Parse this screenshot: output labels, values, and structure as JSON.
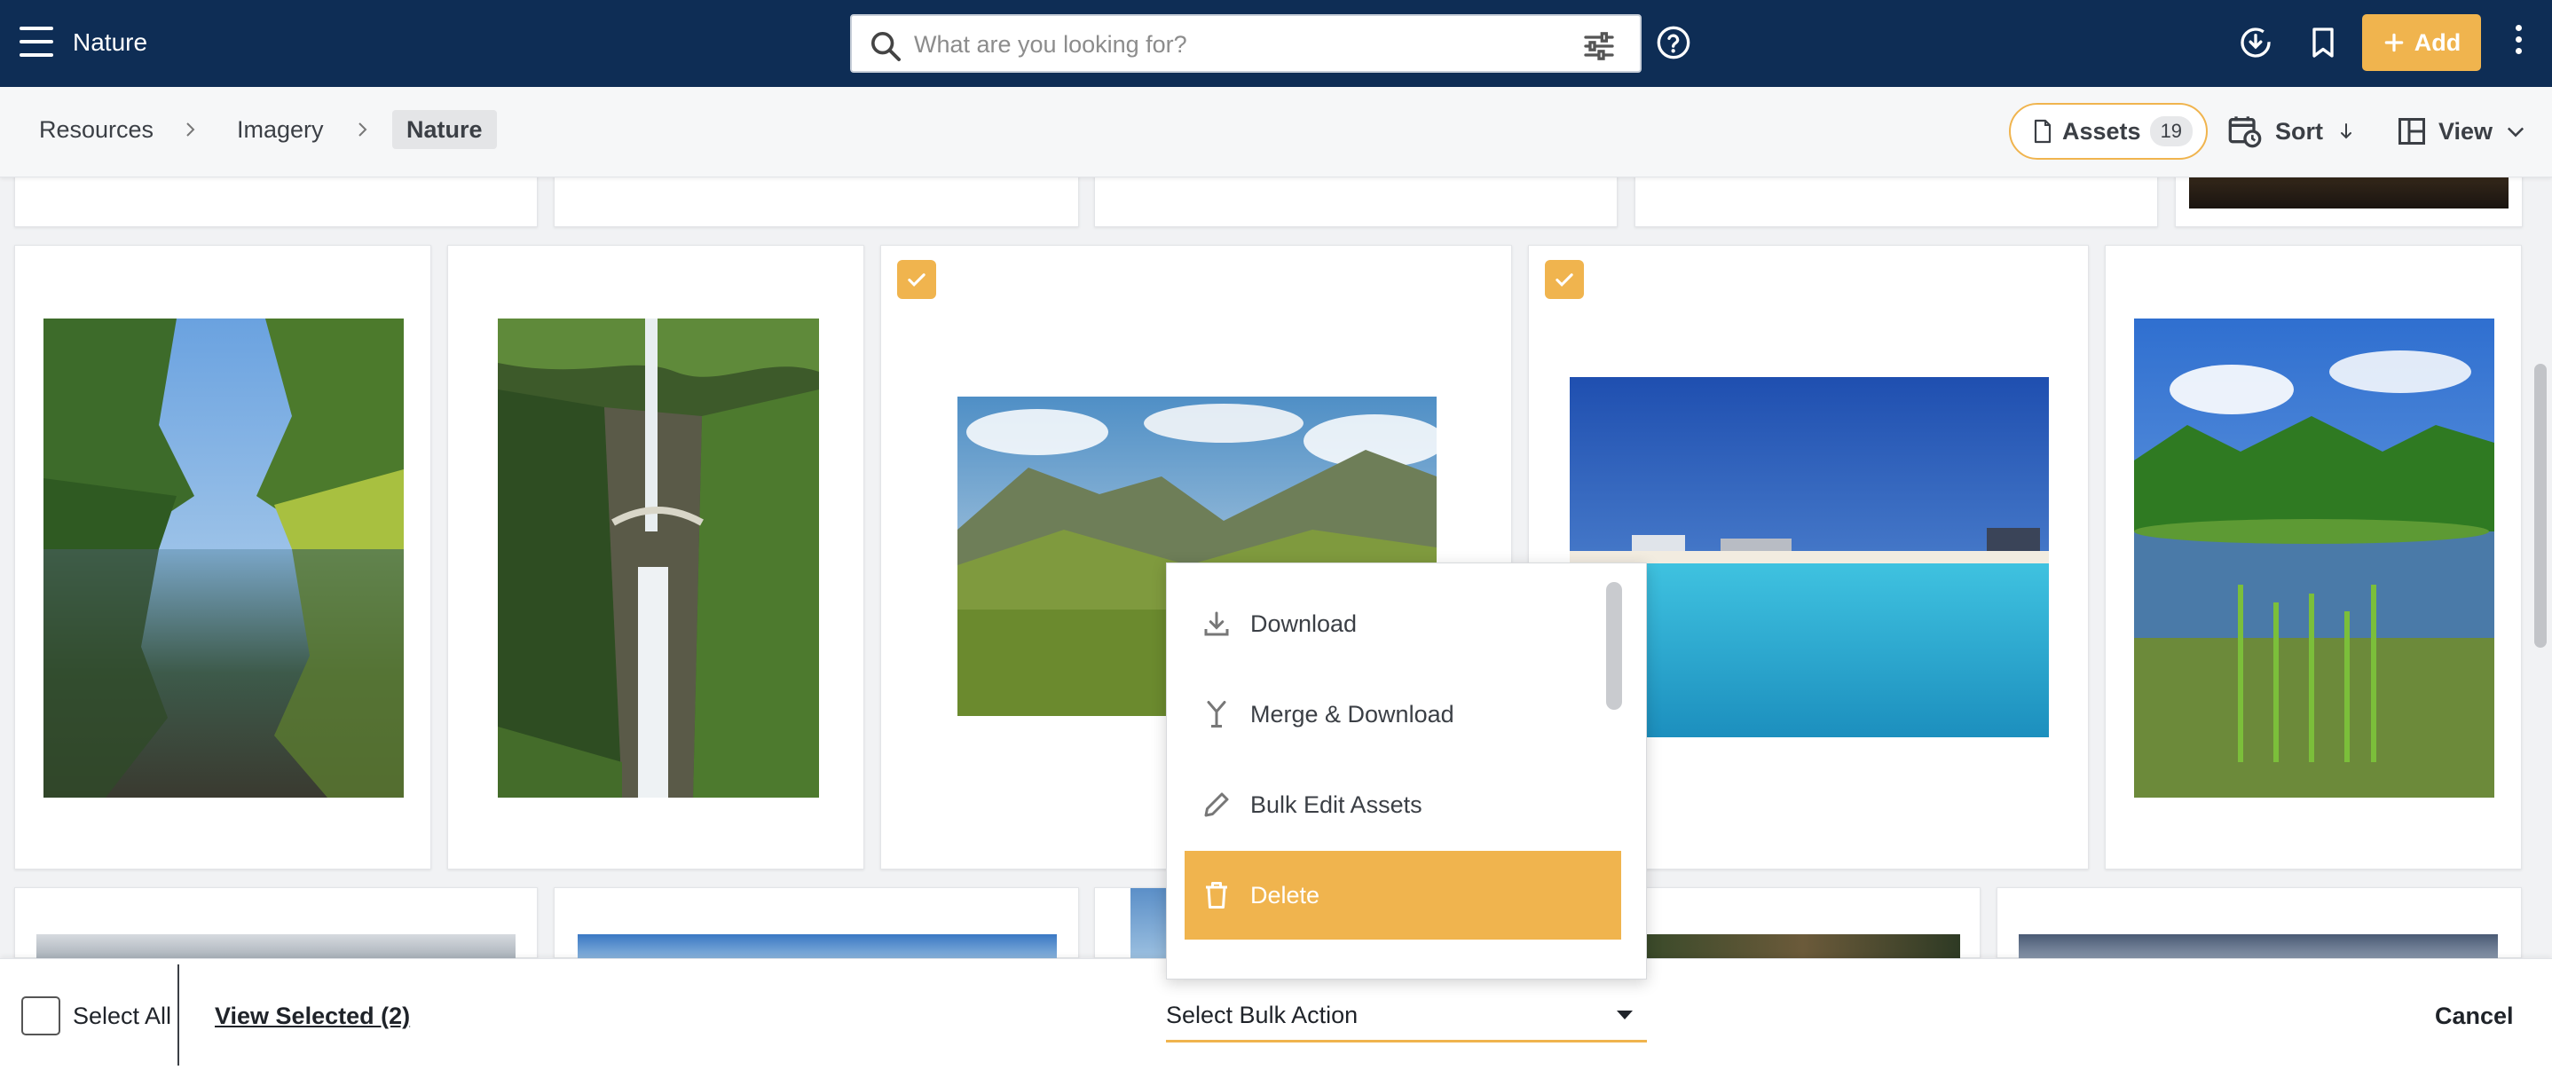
{
  "header": {
    "app_title": "Nature",
    "search_placeholder": "What are you looking for?",
    "add_label": "Add"
  },
  "breadcrumb": {
    "items": [
      "Resources",
      "Imagery"
    ],
    "current": "Nature"
  },
  "toolbar": {
    "assets_label": "Assets",
    "assets_count": "19",
    "sort_label": "Sort",
    "view_label": "View"
  },
  "dropdown": {
    "items": [
      {
        "label": "Download",
        "icon": "download-icon"
      },
      {
        "label": "Merge & Download",
        "icon": "merge-icon"
      },
      {
        "label": "Bulk Edit Assets",
        "icon": "pencil-icon"
      },
      {
        "label": "Delete",
        "icon": "trash-icon",
        "highlighted": true
      }
    ]
  },
  "footer": {
    "select_all_label": "Select All",
    "view_selected_label": "View Selected (2)",
    "bulk_action_label": "Select Bulk Action",
    "cancel_label": "Cancel"
  },
  "colors": {
    "brand_navy": "#0e2d55",
    "accent_orange": "#f0b44e"
  }
}
